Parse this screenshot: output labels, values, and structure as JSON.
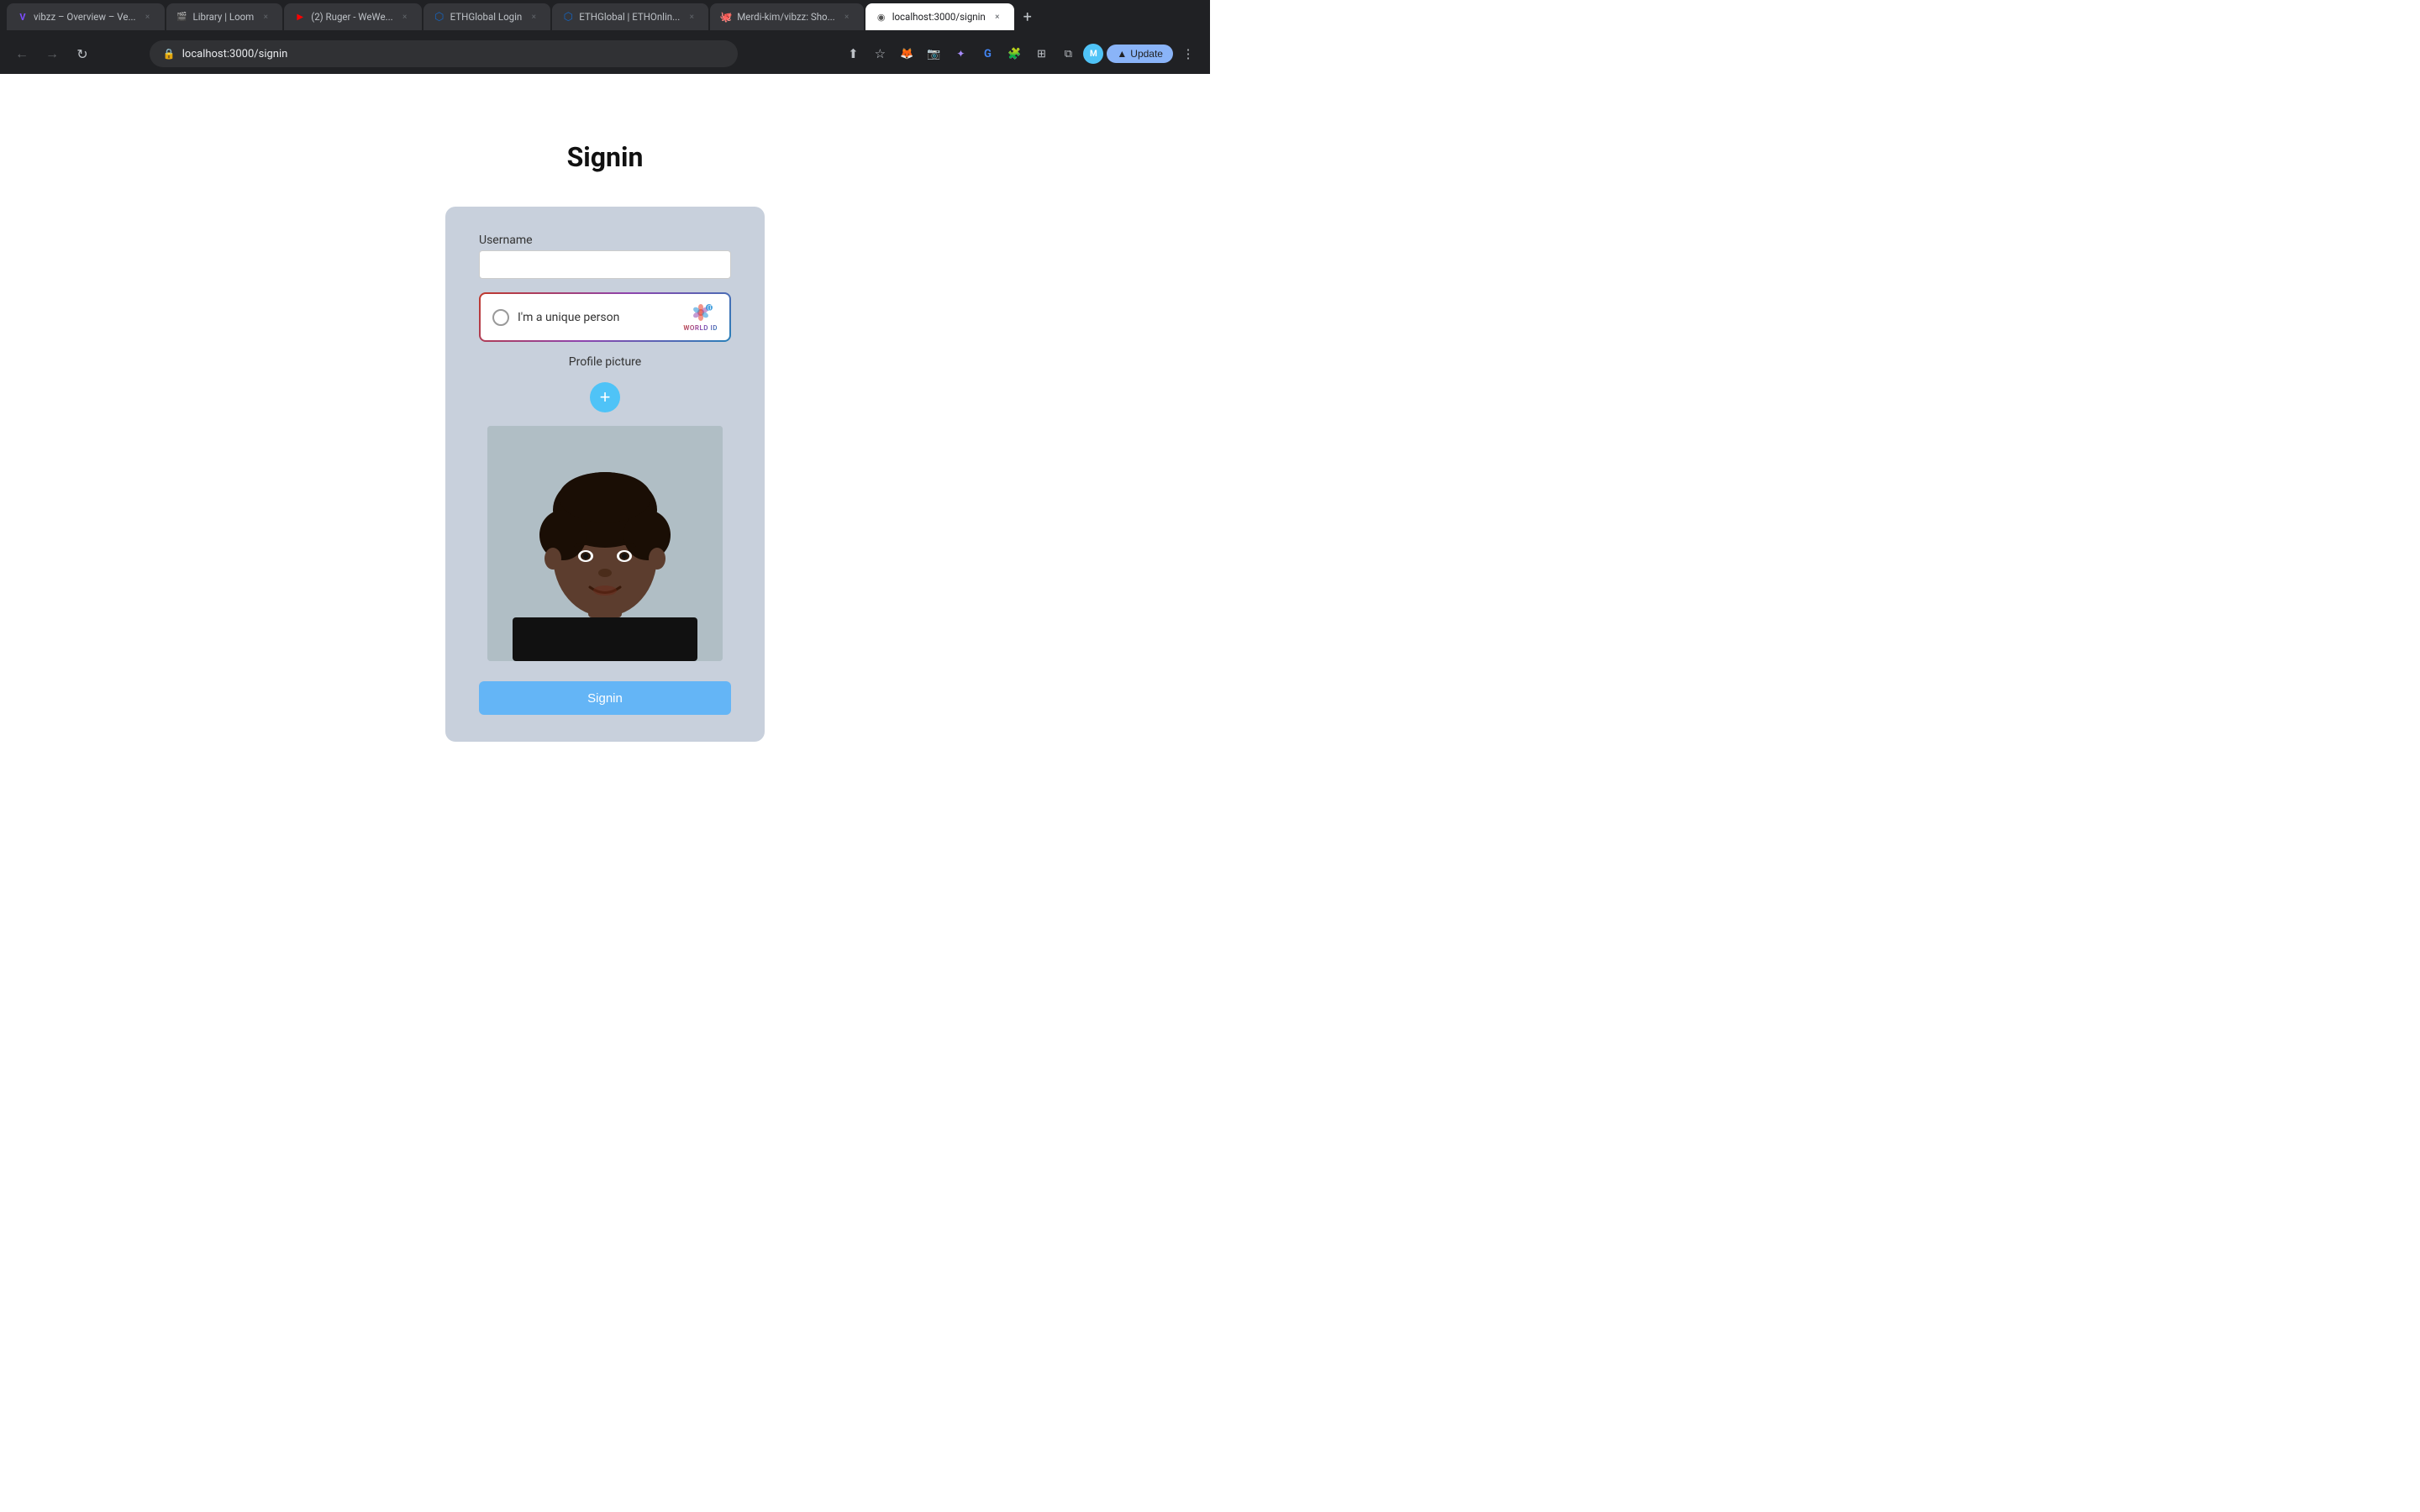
{
  "browser": {
    "address": "localhost:3000/signin",
    "update_label": "Update"
  },
  "tabs": [
    {
      "id": "tab-1",
      "title": "vibzz – Overview – Ve...",
      "favicon": "V",
      "favicon_type": "purple",
      "active": false,
      "closeable": true
    },
    {
      "id": "tab-2",
      "title": "Library | Loom",
      "favicon": "🎬",
      "favicon_type": "loom",
      "active": false,
      "closeable": true
    },
    {
      "id": "tab-3",
      "title": "(2) Ruger - WeWe...",
      "favicon": "▶",
      "favicon_type": "red",
      "active": false,
      "closeable": true
    },
    {
      "id": "tab-4",
      "title": "ETHGlobal Login",
      "favicon": "⬡",
      "favicon_type": "blue",
      "active": false,
      "closeable": true
    },
    {
      "id": "tab-5",
      "title": "ETHGlobal | ETHOnlin...",
      "favicon": "⬡",
      "favicon_type": "blue2",
      "active": false,
      "closeable": true
    },
    {
      "id": "tab-6",
      "title": "Merdi-kim/vibzz: Sho...",
      "favicon": "🐙",
      "favicon_type": "github",
      "active": false,
      "closeable": true
    },
    {
      "id": "tab-7",
      "title": "localhost:3000/signin",
      "favicon": "◉",
      "favicon_type": "gray",
      "active": true,
      "closeable": true
    }
  ],
  "page": {
    "title": "Signin",
    "form": {
      "username_label": "Username",
      "username_placeholder": "",
      "worldid_text": "I'm a unique person",
      "worldid_badge": "ⓘ",
      "worldid_logo_label": "WORLD ID",
      "profile_picture_label": "Profile picture",
      "add_photo_label": "+",
      "signin_button_label": "Signin"
    }
  }
}
